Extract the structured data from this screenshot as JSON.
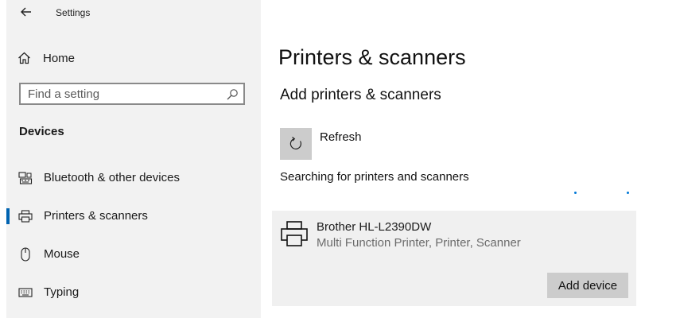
{
  "window": {
    "app_title": "Settings"
  },
  "sidebar": {
    "home_label": "Home",
    "search": {
      "placeholder": "Find a setting"
    },
    "section_heading": "Devices",
    "items": [
      {
        "label": "Bluetooth & other devices",
        "icon": "bluetooth-devices-icon",
        "selected": false
      },
      {
        "label": "Printers & scanners",
        "icon": "printer-icon",
        "selected": true
      },
      {
        "label": "Mouse",
        "icon": "mouse-icon",
        "selected": false
      },
      {
        "label": "Typing",
        "icon": "keyboard-icon",
        "selected": false
      }
    ]
  },
  "main": {
    "title": "Printers & scanners",
    "subtitle": "Add printers & scanners",
    "refresh_label": "Refresh",
    "status": "Searching for printers and scanners",
    "device": {
      "name": "Brother HL-L2390DW",
      "description": "Multi Function Printer, Printer, Scanner",
      "action_label": "Add device"
    }
  },
  "colors": {
    "accent": "#0063b1",
    "sidebar_bg": "#f2f2f2",
    "tile_bg": "#cccccc",
    "card_bg": "#f0f0f0",
    "progress": "#0078d7"
  }
}
